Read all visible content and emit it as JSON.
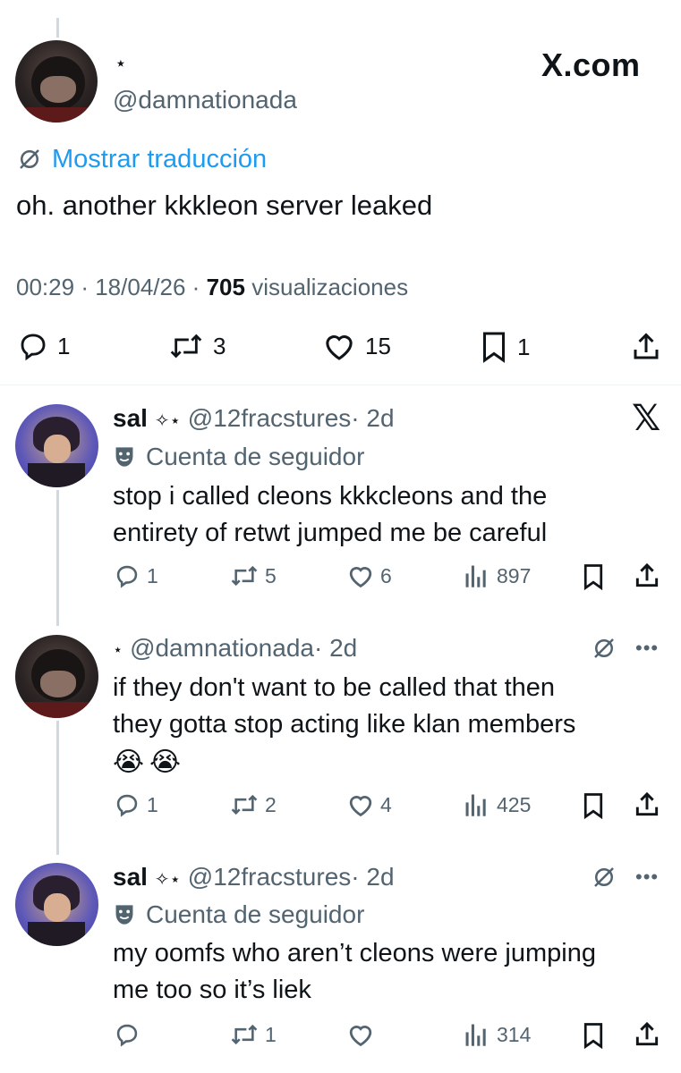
{
  "main_post": {
    "display_name": "⋆",
    "handle": "@damnationada",
    "brand": "X.com",
    "translate_label": "Mostrar traducción",
    "text": "oh. another kkkleon server leaked",
    "time": "00:29",
    "date": "18/04/26",
    "separator": "·",
    "views_count": "705",
    "views_label": "visualizaciones",
    "replies": "1",
    "reposts": "3",
    "likes": "15",
    "bookmarks": "1"
  },
  "replies": [
    {
      "name": "sal",
      "name_suffix": "✧⋆",
      "handle": "@12fracstures",
      "time": "· 2d",
      "badge_label": "Cuenta de seguidor",
      "text_lines": [
        "stop i called cleons kkkcleons and the",
        "entirety of retwt jumped me be careful"
      ],
      "replies": "1",
      "reposts": "5",
      "likes": "6",
      "views": "897"
    },
    {
      "name": "⋆",
      "handle": "@damnationada",
      "time": "· 2d",
      "text_lines": [
        "if they don't want to be called that then",
        "they gotta stop acting like klan members"
      ],
      "emoji": "😭😭",
      "replies": "1",
      "reposts": "2",
      "likes": "4",
      "views": "425"
    },
    {
      "name": "sal",
      "name_suffix": "✧⋆",
      "handle": "@12fracstures",
      "time": "· 2d",
      "badge_label": "Cuenta de seguidor",
      "text_lines": [
        "my oomfs who aren’t cleons were jumping",
        "me too so it’s liek"
      ],
      "replies": "",
      "reposts": "1",
      "likes": "",
      "views": "314"
    }
  ],
  "colors": {
    "link": "#1d9bf0",
    "grey": "#536471",
    "text": "#0f1419",
    "line": "#cfd9de"
  }
}
